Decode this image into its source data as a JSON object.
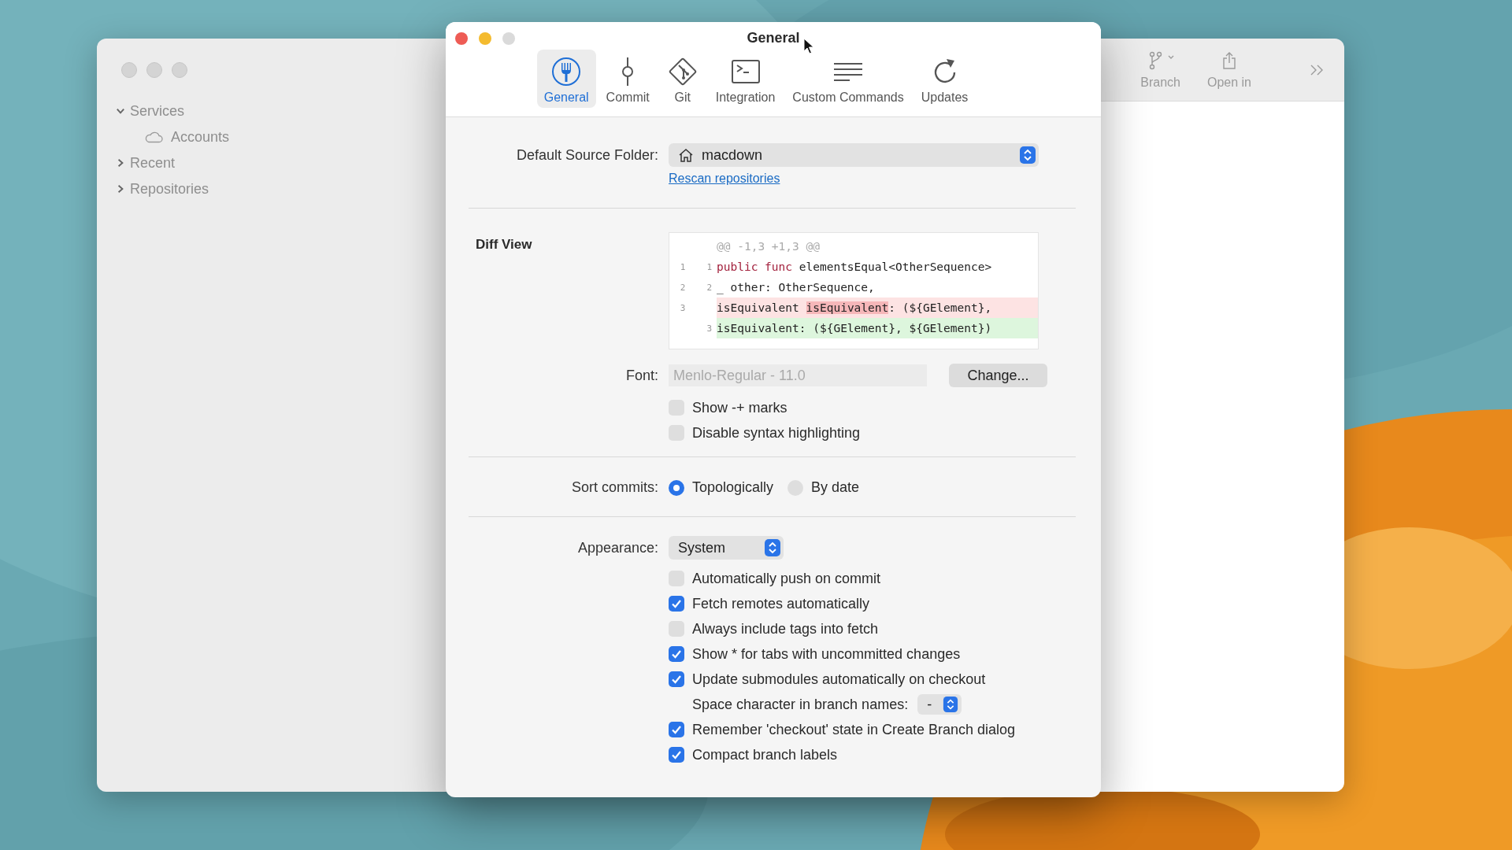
{
  "back_window": {
    "sidebar": {
      "items": [
        {
          "label": "Services",
          "expanded": true,
          "children": [
            {
              "label": "Accounts"
            }
          ]
        },
        {
          "label": "Recent",
          "expanded": false
        },
        {
          "label": "Repositories",
          "expanded": false
        }
      ]
    },
    "toolbar": {
      "items": [
        {
          "kind": "branch",
          "label": "Branch"
        },
        {
          "kind": "share",
          "label": "Open in"
        }
      ]
    }
  },
  "dialog": {
    "title": "General",
    "tabs": [
      {
        "kind": "general",
        "label": "General",
        "selected": true
      },
      {
        "kind": "commit",
        "label": "Commit",
        "selected": false
      },
      {
        "kind": "git",
        "label": "Git",
        "selected": false
      },
      {
        "kind": "integration",
        "label": "Integration",
        "selected": false
      },
      {
        "kind": "commands",
        "label": "Custom Commands",
        "selected": false
      },
      {
        "kind": "updates",
        "label": "Updates",
        "selected": false
      }
    ],
    "source_folder": {
      "label": "Default Source Folder:",
      "value": "macdown",
      "link": "Rescan repositories"
    },
    "diff_view": {
      "title": "Diff View",
      "lines": [
        {
          "kind": "header",
          "segments": [
            {
              "kind": "plain",
              "text": "@@ -1,3 +1,3 @@"
            }
          ]
        },
        {
          "kind": "context",
          "old": "1",
          "new": "1",
          "segments": [
            {
              "kind": "keyword",
              "text": "public func"
            },
            {
              "kind": "plain",
              "text": " elementsEqual<OtherSequence>"
            }
          ]
        },
        {
          "kind": "context",
          "old": "2",
          "new": "2",
          "segments": [
            {
              "kind": "plain",
              "text": "_ other: OtherSequence,"
            }
          ]
        },
        {
          "kind": "removed",
          "old": "3",
          "segments": [
            {
              "kind": "plain",
              "text": "isEquivalent "
            },
            {
              "kind": "changed",
              "text": "isEquivalent"
            },
            {
              "kind": "plain",
              "text": ": (${GElement},"
            }
          ]
        },
        {
          "kind": "added",
          "new": "3",
          "segments": [
            {
              "kind": "plain",
              "text": "isEquivalent: (${GElement}, ${GElement})"
            }
          ]
        }
      ],
      "font": {
        "label": "Font:",
        "value": "Menlo-Regular - 11.0",
        "button": "Change..."
      },
      "options": [
        {
          "label": "Show -+ marks",
          "checked": false
        },
        {
          "label": "Disable syntax highlighting",
          "checked": false
        }
      ]
    },
    "sort_commits": {
      "label": "Sort commits:",
      "options": [
        {
          "label": "Topologically",
          "selected": true
        },
        {
          "label": "By date",
          "selected": false
        }
      ]
    },
    "appearance": {
      "label": "Appearance:",
      "value": "System"
    },
    "auto_settings": [
      {
        "kind": "checkbox",
        "label": "Automatically push on commit",
        "checked": false
      },
      {
        "kind": "checkbox",
        "label": "Fetch remotes automatically",
        "checked": true
      },
      {
        "kind": "checkbox",
        "label": "Always include tags into fetch",
        "checked": false
      },
      {
        "kind": "checkbox",
        "label": "Show * for tabs with uncommitted changes",
        "checked": true
      },
      {
        "kind": "checkbox",
        "label": "Update submodules automatically on checkout",
        "checked": true
      }
    ],
    "branch_space": {
      "label": "Space character in branch names:",
      "value": "-"
    },
    "branch_settings": [
      {
        "kind": "checkbox",
        "label": "Remember 'checkout' state in Create Branch dialog",
        "checked": true
      },
      {
        "kind": "checkbox",
        "label": "Compact branch labels",
        "checked": true
      }
    ]
  }
}
